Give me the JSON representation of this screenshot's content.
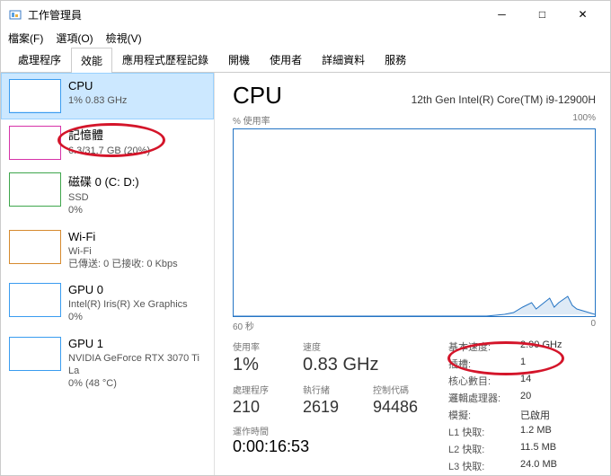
{
  "window": {
    "title": "工作管理員",
    "min": "─",
    "max": "□",
    "close": "✕"
  },
  "menu": {
    "file": "檔案(F)",
    "options": "選項(O)",
    "view": "檢視(V)"
  },
  "tabs": {
    "processes": "處理程序",
    "performance": "效能",
    "history": "應用程式歷程記錄",
    "startup": "開機",
    "users": "使用者",
    "details": "詳細資料",
    "services": "服務"
  },
  "sidebar": {
    "cpu": {
      "title": "CPU",
      "sub": "1%  0.83 GHz"
    },
    "mem": {
      "title": "記憶體",
      "sub": "6.3/31.7 GB (20%)"
    },
    "disk": {
      "title": "磁碟 0 (C: D:)",
      "sub1": "SSD",
      "sub2": "0%"
    },
    "wifi": {
      "title": "Wi-Fi",
      "sub1": "Wi-Fi",
      "sub2": "已傳送: 0  已接收: 0 Kbps"
    },
    "gpu0": {
      "title": "GPU 0",
      "sub1": "Intel(R) Iris(R) Xe Graphics",
      "sub2": "0%"
    },
    "gpu1": {
      "title": "GPU 1",
      "sub1": "NVIDIA GeForce RTX 3070 Ti La",
      "sub2": "0% (48 °C)"
    }
  },
  "main": {
    "title": "CPU",
    "name": "12th Gen Intel(R) Core(TM) i9-12900H",
    "graph_label_left": "% 使用率",
    "graph_label_right": "100%",
    "graph_bottom_left": "60 秒",
    "graph_bottom_right": "0",
    "stats": {
      "usage_label": "使用率",
      "usage": "1%",
      "speed_label": "速度",
      "speed": "0.83 GHz",
      "processes_label": "處理程序",
      "processes": "210",
      "threads_label": "執行緒",
      "threads": "2619",
      "handles_label": "控制代碼",
      "handles": "94486",
      "uptime_label": "運作時間",
      "uptime": "0:00:16:53"
    },
    "specs": {
      "base_label": "基本速度:",
      "base": "2.90 GHz",
      "sockets_label": "插槽:",
      "sockets": "1",
      "cores_label": "核心數目:",
      "cores": "14",
      "logical_label": "邏輯處理器:",
      "logical": "20",
      "virt_label": "模擬:",
      "virt": "已啟用",
      "l1_label": "L1 快取:",
      "l1": "1.2 MB",
      "l2_label": "L2 快取:",
      "l2": "11.5 MB",
      "l3_label": "L3 快取:",
      "l3": "24.0 MB"
    }
  },
  "chart_data": {
    "type": "line",
    "title": "% 使用率",
    "xlabel": "60 秒",
    "ylabel": "% 使用率",
    "ylim": [
      0,
      100
    ],
    "x_range_seconds": [
      60,
      0
    ],
    "series": [
      {
        "name": "CPU 使用率",
        "values_approx_percent": [
          0,
          0,
          0,
          0,
          0,
          0,
          0,
          0,
          0,
          0,
          0,
          0,
          0,
          0,
          0,
          0,
          0,
          0,
          0,
          0,
          0,
          0,
          0,
          0,
          0,
          0,
          0,
          0,
          0,
          0,
          0,
          0,
          0,
          0,
          0,
          0,
          0,
          0,
          0,
          0,
          0,
          0,
          0,
          0,
          0,
          1,
          2,
          4,
          8,
          6,
          3,
          5,
          7,
          4,
          2,
          3,
          5,
          3,
          2,
          1
        ]
      }
    ]
  }
}
